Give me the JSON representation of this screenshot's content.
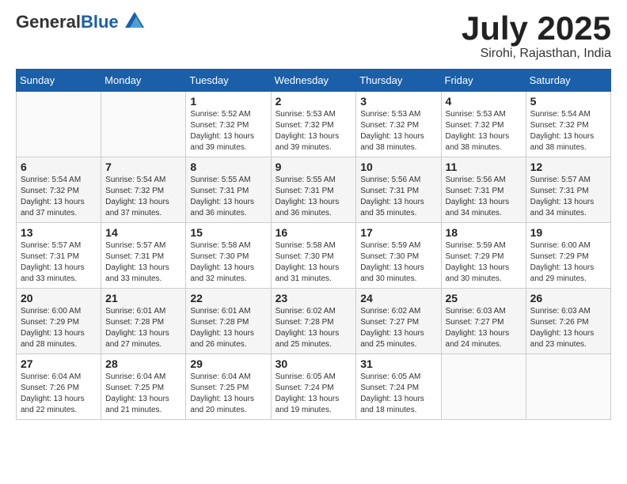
{
  "header": {
    "logo": {
      "general": "General",
      "blue": "Blue"
    },
    "month": "July 2025",
    "location": "Sirohi, Rajasthan, India"
  },
  "weekdays": [
    "Sunday",
    "Monday",
    "Tuesday",
    "Wednesday",
    "Thursday",
    "Friday",
    "Saturday"
  ],
  "weeks": [
    [
      {
        "day": "",
        "details": ""
      },
      {
        "day": "",
        "details": ""
      },
      {
        "day": "1",
        "details": "Sunrise: 5:52 AM\nSunset: 7:32 PM\nDaylight: 13 hours and 39 minutes."
      },
      {
        "day": "2",
        "details": "Sunrise: 5:53 AM\nSunset: 7:32 PM\nDaylight: 13 hours and 39 minutes."
      },
      {
        "day": "3",
        "details": "Sunrise: 5:53 AM\nSunset: 7:32 PM\nDaylight: 13 hours and 38 minutes."
      },
      {
        "day": "4",
        "details": "Sunrise: 5:53 AM\nSunset: 7:32 PM\nDaylight: 13 hours and 38 minutes."
      },
      {
        "day": "5",
        "details": "Sunrise: 5:54 AM\nSunset: 7:32 PM\nDaylight: 13 hours and 38 minutes."
      }
    ],
    [
      {
        "day": "6",
        "details": "Sunrise: 5:54 AM\nSunset: 7:32 PM\nDaylight: 13 hours and 37 minutes."
      },
      {
        "day": "7",
        "details": "Sunrise: 5:54 AM\nSunset: 7:32 PM\nDaylight: 13 hours and 37 minutes."
      },
      {
        "day": "8",
        "details": "Sunrise: 5:55 AM\nSunset: 7:31 PM\nDaylight: 13 hours and 36 minutes."
      },
      {
        "day": "9",
        "details": "Sunrise: 5:55 AM\nSunset: 7:31 PM\nDaylight: 13 hours and 36 minutes."
      },
      {
        "day": "10",
        "details": "Sunrise: 5:56 AM\nSunset: 7:31 PM\nDaylight: 13 hours and 35 minutes."
      },
      {
        "day": "11",
        "details": "Sunrise: 5:56 AM\nSunset: 7:31 PM\nDaylight: 13 hours and 34 minutes."
      },
      {
        "day": "12",
        "details": "Sunrise: 5:57 AM\nSunset: 7:31 PM\nDaylight: 13 hours and 34 minutes."
      }
    ],
    [
      {
        "day": "13",
        "details": "Sunrise: 5:57 AM\nSunset: 7:31 PM\nDaylight: 13 hours and 33 minutes."
      },
      {
        "day": "14",
        "details": "Sunrise: 5:57 AM\nSunset: 7:31 PM\nDaylight: 13 hours and 33 minutes."
      },
      {
        "day": "15",
        "details": "Sunrise: 5:58 AM\nSunset: 7:30 PM\nDaylight: 13 hours and 32 minutes."
      },
      {
        "day": "16",
        "details": "Sunrise: 5:58 AM\nSunset: 7:30 PM\nDaylight: 13 hours and 31 minutes."
      },
      {
        "day": "17",
        "details": "Sunrise: 5:59 AM\nSunset: 7:30 PM\nDaylight: 13 hours and 30 minutes."
      },
      {
        "day": "18",
        "details": "Sunrise: 5:59 AM\nSunset: 7:29 PM\nDaylight: 13 hours and 30 minutes."
      },
      {
        "day": "19",
        "details": "Sunrise: 6:00 AM\nSunset: 7:29 PM\nDaylight: 13 hours and 29 minutes."
      }
    ],
    [
      {
        "day": "20",
        "details": "Sunrise: 6:00 AM\nSunset: 7:29 PM\nDaylight: 13 hours and 28 minutes."
      },
      {
        "day": "21",
        "details": "Sunrise: 6:01 AM\nSunset: 7:28 PM\nDaylight: 13 hours and 27 minutes."
      },
      {
        "day": "22",
        "details": "Sunrise: 6:01 AM\nSunset: 7:28 PM\nDaylight: 13 hours and 26 minutes."
      },
      {
        "day": "23",
        "details": "Sunrise: 6:02 AM\nSunset: 7:28 PM\nDaylight: 13 hours and 25 minutes."
      },
      {
        "day": "24",
        "details": "Sunrise: 6:02 AM\nSunset: 7:27 PM\nDaylight: 13 hours and 25 minutes."
      },
      {
        "day": "25",
        "details": "Sunrise: 6:03 AM\nSunset: 7:27 PM\nDaylight: 13 hours and 24 minutes."
      },
      {
        "day": "26",
        "details": "Sunrise: 6:03 AM\nSunset: 7:26 PM\nDaylight: 13 hours and 23 minutes."
      }
    ],
    [
      {
        "day": "27",
        "details": "Sunrise: 6:04 AM\nSunset: 7:26 PM\nDaylight: 13 hours and 22 minutes."
      },
      {
        "day": "28",
        "details": "Sunrise: 6:04 AM\nSunset: 7:25 PM\nDaylight: 13 hours and 21 minutes."
      },
      {
        "day": "29",
        "details": "Sunrise: 6:04 AM\nSunset: 7:25 PM\nDaylight: 13 hours and 20 minutes."
      },
      {
        "day": "30",
        "details": "Sunrise: 6:05 AM\nSunset: 7:24 PM\nDaylight: 13 hours and 19 minutes."
      },
      {
        "day": "31",
        "details": "Sunrise: 6:05 AM\nSunset: 7:24 PM\nDaylight: 13 hours and 18 minutes."
      },
      {
        "day": "",
        "details": ""
      },
      {
        "day": "",
        "details": ""
      }
    ]
  ]
}
